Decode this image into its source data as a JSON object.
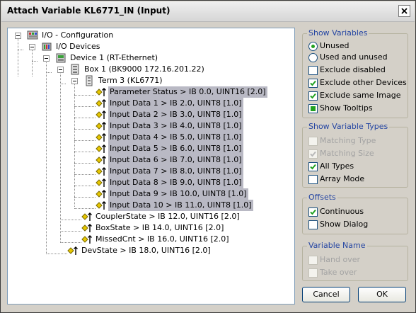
{
  "window": {
    "title": "Attach Variable KL6771_IN (Input)"
  },
  "tree": {
    "root": "I/O - Configuration",
    "io_devices": "I/O Devices",
    "device": "Device 1 (RT-Ethernet)",
    "box": "Box 1 (BK9000 172.16.201.22)",
    "term": "Term 3 (KL6771)",
    "term_vars": [
      "Parameter Status   >   IB 0.0, UINT16 [2.0]",
      "Input Data 1   >   IB 2.0, UINT8 [1.0]",
      "Input Data 2   >   IB 3.0, UINT8 [1.0]",
      "Input Data 3   >   IB 4.0, UINT8 [1.0]",
      "Input Data 4   >   IB 5.0, UINT8 [1.0]",
      "Input Data 5   >   IB 6.0, UINT8 [1.0]",
      "Input Data 6   >   IB 7.0, UINT8 [1.0]",
      "Input Data 7   >   IB 8.0, UINT8 [1.0]",
      "Input Data 8   >   IB 9.0, UINT8 [1.0]",
      "Input Data 9   >   IB 10.0, UINT8 [1.0]",
      "Input Data 10   >   IB 11.0, UINT8 [1.0]"
    ],
    "box_vars": [
      "CouplerState   >   IB 12.0, UINT16 [2.0]",
      "BoxState   >   IB 14.0, UINT16 [2.0]",
      "MissedCnt   >   IB 16.0, UINT16 [2.0]"
    ],
    "dev_var": "DevState   >   IB 18.0, UINT16 [2.0]"
  },
  "show_variables": {
    "title": "Show Variables",
    "unused": "Unused",
    "used_and_unused": "Used and unused",
    "exclude_disabled": "Exclude disabled",
    "exclude_other_devices": "Exclude other Devices",
    "exclude_same_image": "Exclude same Image",
    "show_tooltips": "Show Tooltips"
  },
  "show_variable_types": {
    "title": "Show Variable Types",
    "matching_type": "Matching Type",
    "matching_size": "Matching Size",
    "all_types": "All Types",
    "array_mode": "Array Mode"
  },
  "offsets": {
    "title": "Offsets",
    "continuous": "Continuous",
    "show_dialog": "Show Dialog"
  },
  "variable_name": {
    "title": "Variable Name",
    "hand_over": "Hand over",
    "take_over": "Take over"
  },
  "buttons": {
    "cancel": "Cancel",
    "ok": "OK"
  },
  "colors": {
    "selection": "#b9b9c4",
    "group_title": "#2445a2",
    "check": "#21a121"
  }
}
